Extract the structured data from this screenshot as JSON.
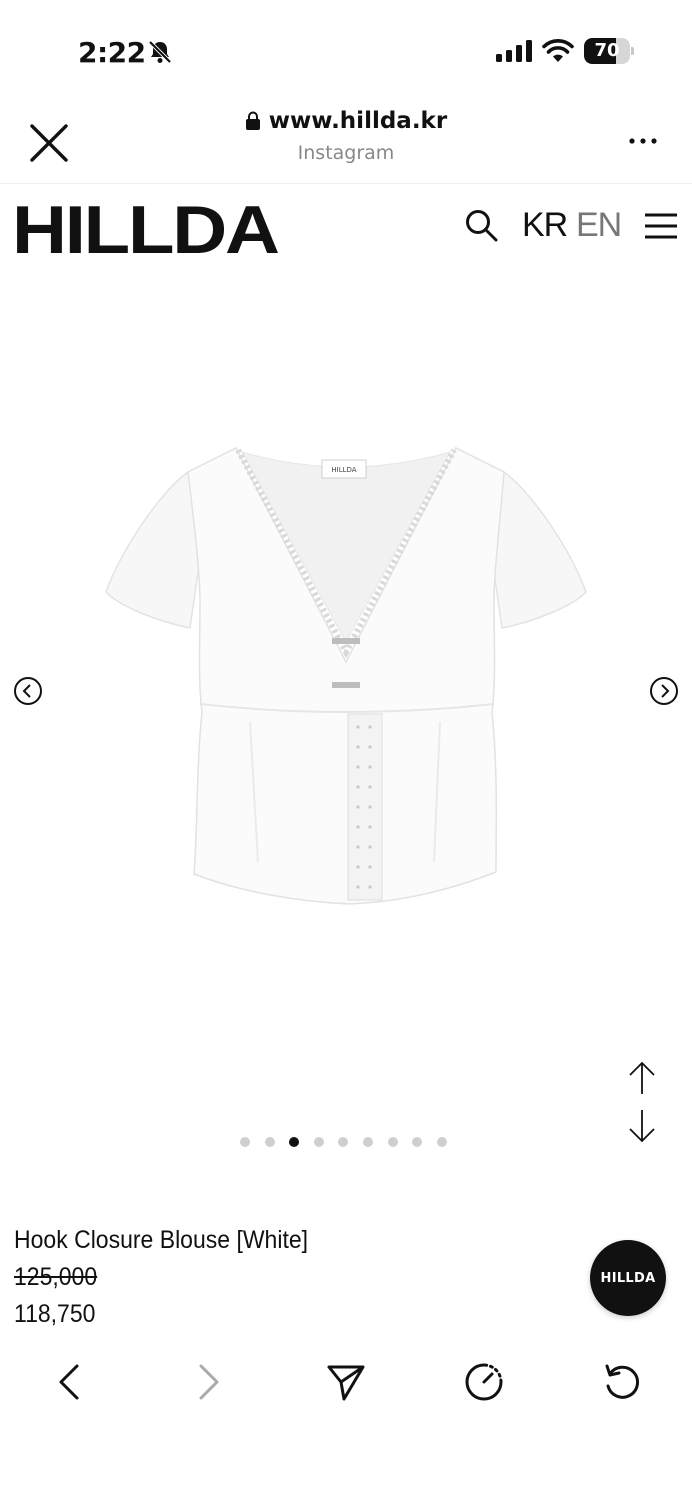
{
  "status_bar": {
    "time": "2:22",
    "battery_level": "70",
    "battery_fraction": 0.7,
    "icons": [
      "bell-slash-icon",
      "signal-icon",
      "wifi-icon",
      "battery-icon"
    ]
  },
  "browser": {
    "url": "www.hillda.kr",
    "source": "Instagram",
    "icons": [
      "close-icon",
      "lock-icon",
      "more-icon"
    ]
  },
  "site_header": {
    "logo": "HILLDA",
    "lang_kr": "KR",
    "lang_en": "EN",
    "icons": [
      "search-icon",
      "hamburger-menu-icon"
    ]
  },
  "gallery": {
    "total_slides": 9,
    "active_index": 2,
    "icons": [
      "arrow-left-circle-icon",
      "arrow-right-circle-icon",
      "arrow-up-icon",
      "arrow-down-icon"
    ]
  },
  "product": {
    "name": "Hook Closure Blouse [White]",
    "original_price": "125,000",
    "sale_price": "118,750"
  },
  "chat_button": {
    "label": "HILLDA"
  },
  "toolbar": {
    "icons": [
      "back-icon",
      "forward-icon",
      "share-icon",
      "timer-icon",
      "reload-icon"
    ]
  }
}
